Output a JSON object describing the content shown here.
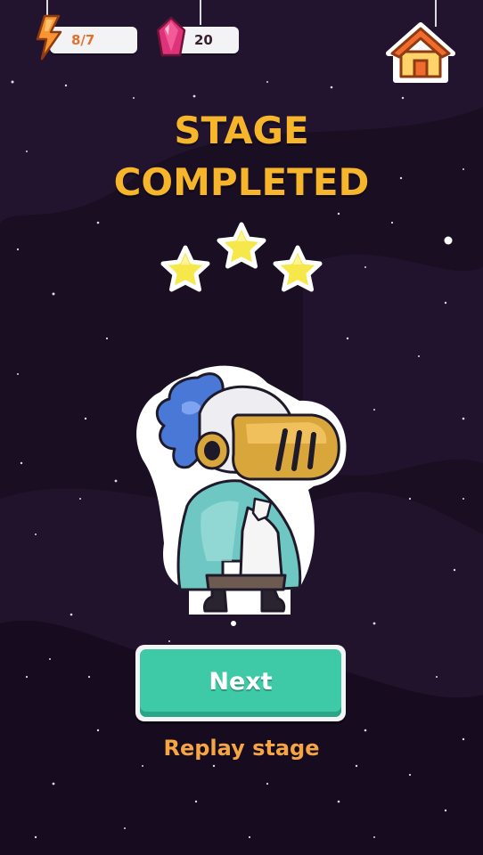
{
  "hud": {
    "energy_value": "8/7",
    "gem_value": "20"
  },
  "screen": {
    "title_line1": "STAGE",
    "title_line2": "COMPLETED"
  },
  "stars": {
    "earned": 3,
    "total": 3
  },
  "actions": {
    "next_label": "Next",
    "replay_label": "Replay stage"
  },
  "colors": {
    "background": "#1a0f22",
    "title": "#f7b52c",
    "star": "#f6e84a",
    "next_button": "#3ec9a7",
    "replay_text": "#f5a544",
    "energy_text": "#e0722e",
    "gem_text": "#3a1f2e",
    "gem": "#e0327a",
    "home_roof": "#f26b2e"
  },
  "icons": {
    "energy": "lightning-bolt",
    "gem": "pink-gem",
    "home": "house",
    "star": "star"
  }
}
